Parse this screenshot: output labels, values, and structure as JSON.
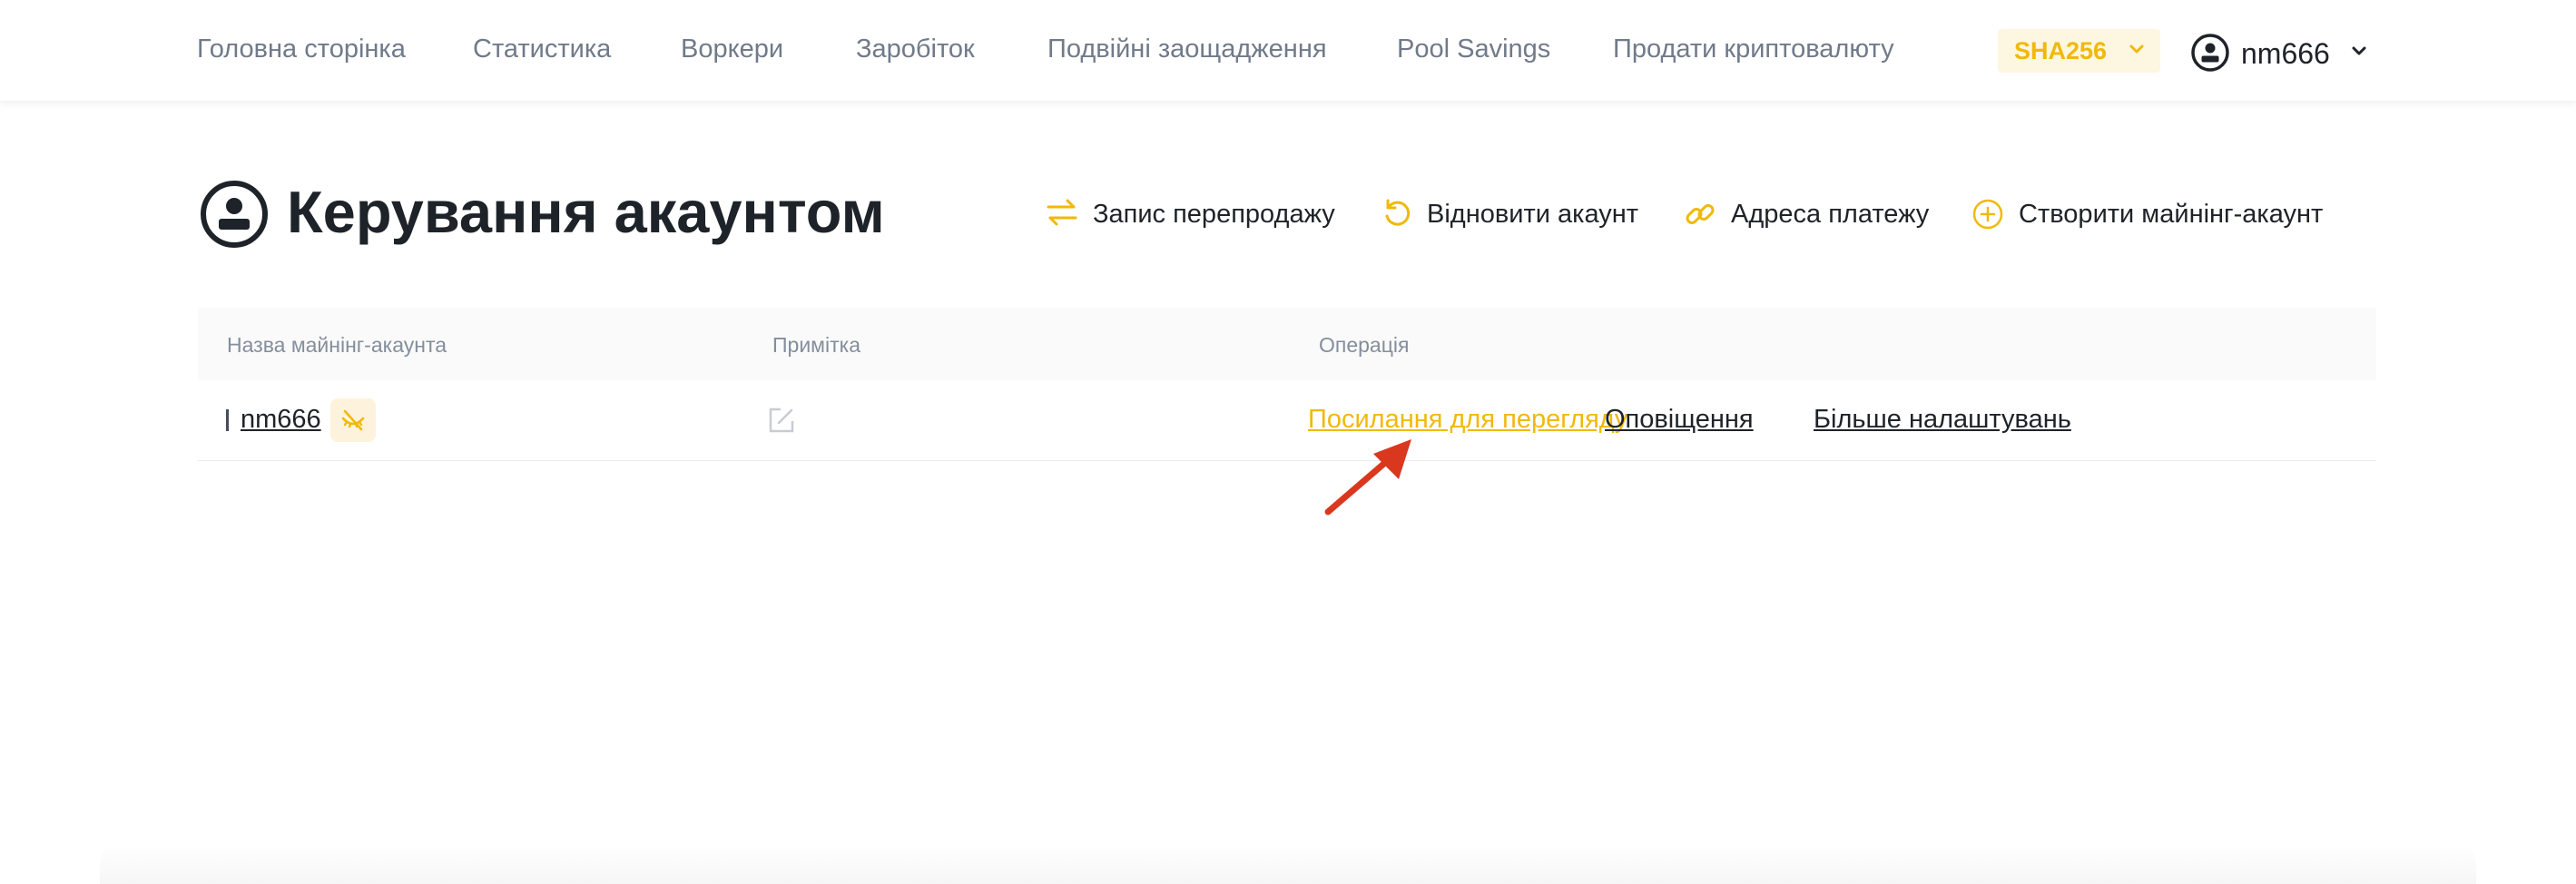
{
  "nav": {
    "items": [
      {
        "label": "Головна сторінка"
      },
      {
        "label": "Статистика"
      },
      {
        "label": "Воркери"
      },
      {
        "label": "Заробіток"
      },
      {
        "label": "Подвійні заощадження"
      },
      {
        "label": "Pool Savings"
      },
      {
        "label": "Продати криптовалюту"
      }
    ],
    "algorithm": {
      "selected": "SHA256"
    },
    "user": {
      "name": "nm666"
    }
  },
  "header": {
    "title": "Керування акаунтом",
    "actions": [
      {
        "label": "Запис перепродажу",
        "icon": "transfer-icon"
      },
      {
        "label": "Відновити акаунт",
        "icon": "restore-icon"
      },
      {
        "label": "Адреса платежу",
        "icon": "link-icon"
      },
      {
        "label": "Створити майнінг-акаунт",
        "icon": "plus-circle-icon"
      }
    ]
  },
  "table": {
    "columns": [
      "Назва майнінг-акаунта",
      "Примітка",
      "Операція"
    ],
    "rows": [
      {
        "account": "nm666",
        "note": "",
        "operations": [
          "Посилання для перегляду",
          "Оповіщення",
          "Більше налаштувань"
        ]
      }
    ]
  },
  "colors": {
    "accent": "#f0b90b",
    "text": "#1e2329",
    "muted": "#707a8a",
    "annotation": "#d9381e"
  }
}
